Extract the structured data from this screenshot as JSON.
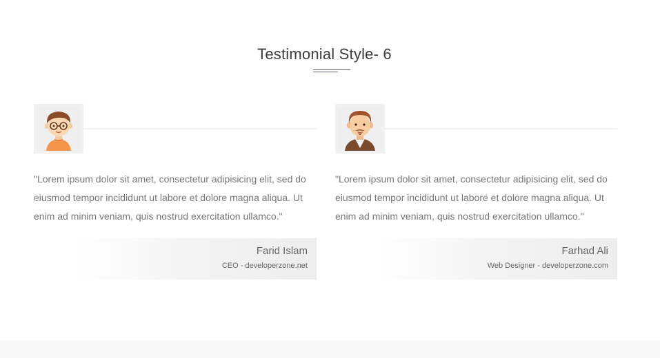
{
  "section": {
    "title": "Testimonial Style- 6"
  },
  "testimonials": [
    {
      "quote": "\"Lorem ipsum dolor sit amet, consectetur adipisicing elit, sed do eiusmod tempor incididunt ut labore et dolore magna aliqua. Ut enim ad minim veniam, quis nostrud exercitation ullamco.\"",
      "name": "Farid Islam",
      "role": "CEO - developerzone.net",
      "avatar_icon": "boy-with-glasses-avatar-icon"
    },
    {
      "quote": "\"Lorem ipsum dolor sit amet, consectetur adipisicing elit, sed do eiusmod tempor incididunt ut labore et dolore magna aliqua. Ut enim ad minim veniam, quis nostrud exercitation ullamco.\"",
      "name": "Farhad Ali",
      "role": "Web Designer - developerzone.com",
      "avatar_icon": "bearded-man-avatar-icon"
    }
  ],
  "colors": {
    "title_text": "#3b3b3b",
    "body_text": "#777777",
    "author_text": "#666666",
    "underline": "#555a66",
    "avatar_bg": "#f1f1f1",
    "footer_band": "#f8f8f8"
  }
}
